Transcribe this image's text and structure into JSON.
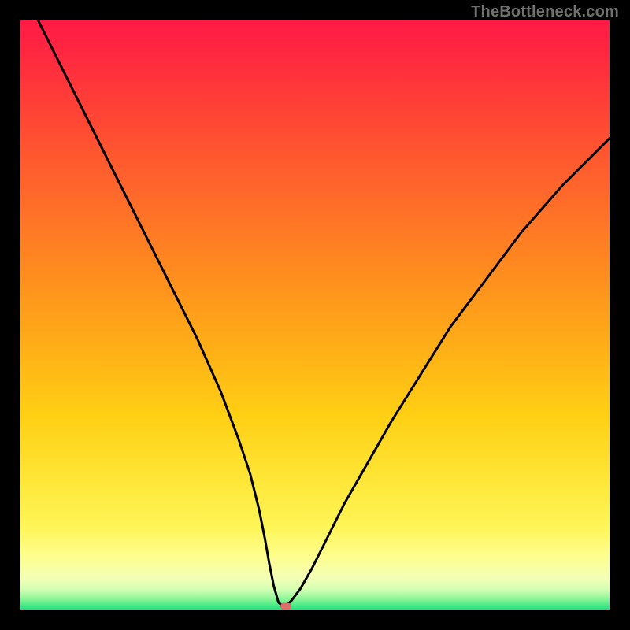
{
  "watermark": "TheBottleneck.com",
  "chart_data": {
    "type": "line",
    "title": "",
    "xlabel": "",
    "ylabel": "",
    "xlim": [
      0,
      100
    ],
    "ylim": [
      0,
      100
    ],
    "grid": false,
    "legend": false,
    "series": [
      {
        "name": "curve",
        "x": [
          3,
          6,
          10,
          14,
          18,
          22,
          26,
          30,
          34,
          37,
          39,
          40.5,
          41.5,
          42.2,
          43.0,
          43.8,
          44.5,
          45.0,
          46.0,
          47.5,
          49.5,
          52,
          55,
          59,
          63,
          68,
          73,
          79,
          85,
          92,
          100
        ],
        "y": [
          100,
          94,
          86,
          78,
          70,
          62,
          54,
          46,
          37,
          29,
          23,
          17,
          12,
          8,
          4,
          1.2,
          0.6,
          0.6,
          1.5,
          3.5,
          7,
          12,
          18,
          25,
          32,
          40,
          48,
          56,
          64,
          72,
          80
        ]
      }
    ],
    "marker": {
      "x": 45.0,
      "y": 0.6
    },
    "colors": {
      "curve_stroke": "#000000",
      "marker_fill": "#df6d6a"
    }
  }
}
